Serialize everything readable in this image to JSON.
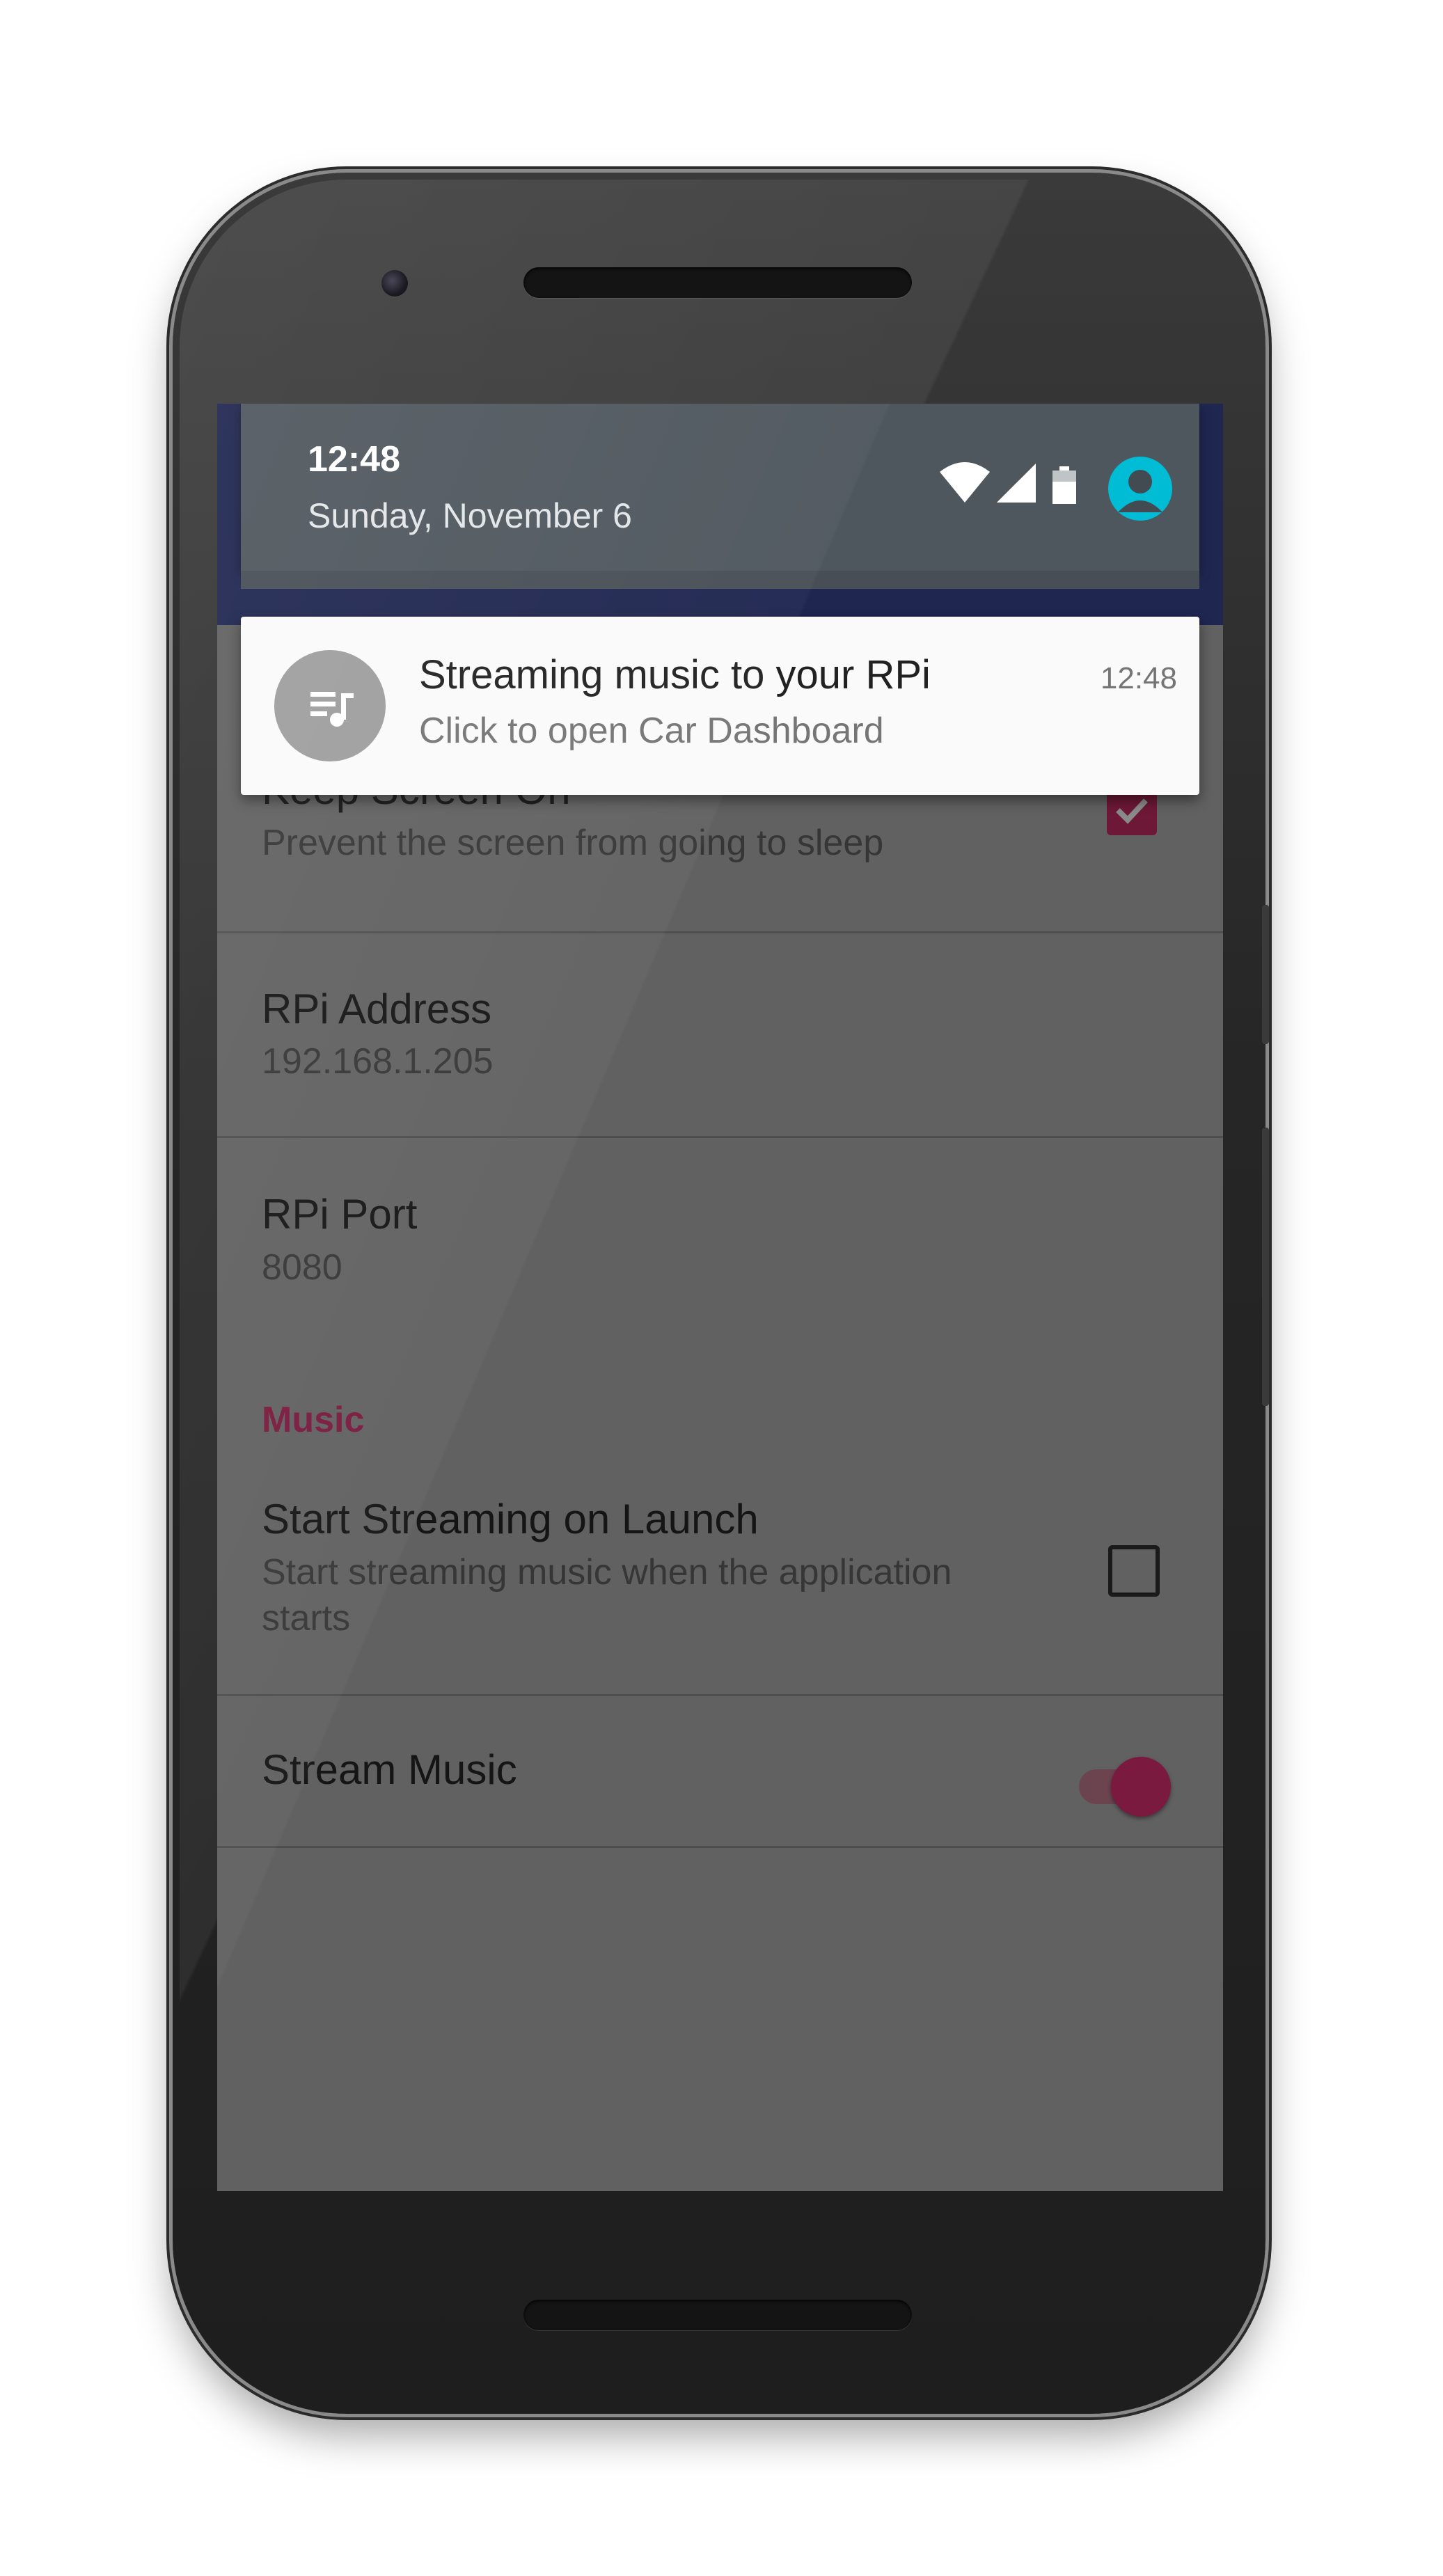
{
  "status_shade": {
    "time": "12:48",
    "date": "Sunday, November 6"
  },
  "icons": {
    "wifi": "wifi-icon",
    "signal": "signal-icon",
    "battery": "battery-icon",
    "account": "account-icon",
    "playlist": "playlist-music-icon"
  },
  "notification": {
    "title": "Streaming music to your RPi",
    "text": "Click to open Car Dashboard",
    "time": "12:48"
  },
  "preferences": {
    "keep_screen_on": {
      "title": "Keep Screen On",
      "summary": "Prevent the screen from going to sleep",
      "checked": true
    },
    "rpi_address": {
      "title": "RPi Address",
      "summary": "192.168.1.205"
    },
    "rpi_port": {
      "title": "RPi Port",
      "summary": "8080"
    },
    "music_category": "Music",
    "start_streaming": {
      "title": "Start Streaming on Launch",
      "summary": "Start streaming music when the application starts",
      "checked": false
    },
    "stream_music": {
      "title": "Stream Music",
      "enabled": true
    }
  },
  "colors": {
    "accent": "#7a1a3e",
    "avatar": "#00bcd4",
    "appbar": "#1f2650"
  }
}
